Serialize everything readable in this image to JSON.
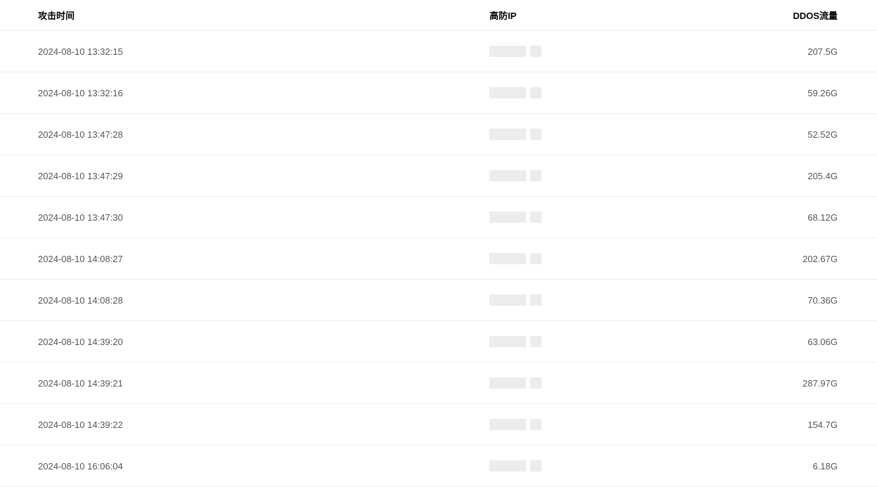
{
  "table": {
    "headers": {
      "time": "攻击时间",
      "ip": "高防IP",
      "traffic": "DDOS流量"
    },
    "rows": [
      {
        "time": "2024-08-10 13:32:15",
        "traffic": "207.5G"
      },
      {
        "time": "2024-08-10 13:32:16",
        "traffic": "59.26G"
      },
      {
        "time": "2024-08-10 13:47:28",
        "traffic": "52.52G"
      },
      {
        "time": "2024-08-10 13:47:29",
        "traffic": "205.4G"
      },
      {
        "time": "2024-08-10 13:47:30",
        "traffic": "68.12G"
      },
      {
        "time": "2024-08-10 14:08:27",
        "traffic": "202.67G"
      },
      {
        "time": "2024-08-10 14:08:28",
        "traffic": "70.36G"
      },
      {
        "time": "2024-08-10 14:39:20",
        "traffic": "63.06G"
      },
      {
        "time": "2024-08-10 14:39:21",
        "traffic": "287.97G"
      },
      {
        "time": "2024-08-10 14:39:22",
        "traffic": "154.7G"
      },
      {
        "time": "2024-08-10 16:06:04",
        "traffic": "6.18G"
      }
    ]
  }
}
